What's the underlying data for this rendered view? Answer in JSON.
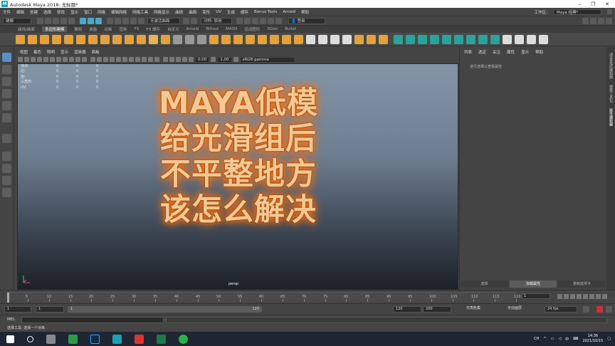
{
  "window": {
    "title": "Autodesk Maya 2018: 无标题*",
    "minimize": "–",
    "maximize": "❐",
    "close": "✕"
  },
  "menu": {
    "items": [
      "文件",
      "编辑",
      "创建",
      "选择",
      "修改",
      "显示",
      "窗口",
      "网格",
      "编辑网格",
      "网格工具",
      "网格显示",
      "曲线",
      "曲面",
      "变形",
      "UV",
      "生成",
      "缓存",
      "Bonus Tools",
      "Arnold",
      "帮助"
    ],
    "workspace_label": "工作区:",
    "workspace_value": "Maya 经典*"
  },
  "statusline": {
    "mode": "建模",
    "live_surface": "无激活曲面",
    "symmetry": "对称: 禁用",
    "login": "登录"
  },
  "shelf": {
    "tabs": [
      "曲线/曲面",
      "多边形建模",
      "雕刻",
      "装备",
      "动画",
      "渲染",
      "FX",
      "FX 缓存",
      "自定义",
      "Arnold",
      "Bifrost",
      "MASH",
      "运动图形",
      "XGen",
      "Bullet"
    ],
    "active_tab": "多边形建模"
  },
  "viewport": {
    "menu": [
      "视图",
      "着色",
      "照明",
      "显示",
      "渲染器",
      "面板"
    ],
    "toolbar": {
      "value_a": "0.00",
      "value_b": "1.00",
      "color_space": "sRGB gamma"
    },
    "hud": [
      {
        "label": "顶点:",
        "a": "0",
        "b": "0",
        "c": "0"
      },
      {
        "label": "边:",
        "a": "0",
        "b": "0",
        "c": "0"
      },
      {
        "label": "面:",
        "a": "0",
        "b": "0",
        "c": "0"
      },
      {
        "label": "三角形:",
        "a": "0",
        "b": "0",
        "c": "0"
      },
      {
        "label": "UV:",
        "a": "0",
        "b": "0",
        "c": "0"
      }
    ],
    "overlay_lines": [
      "MAYA低模",
      "给光滑组后",
      "不平整地方",
      "该怎么解决"
    ],
    "camera": "persp"
  },
  "channel_box": {
    "menu": [
      "列表",
      "选定",
      "关注",
      "属性",
      "显示",
      "帮助"
    ],
    "info": "进行选择以查看属性",
    "tabs": [
      "选择",
      "加载属性",
      "复制选项卡"
    ],
    "active_tab": "加载属性"
  },
  "side_tabs": [
    "通道盒/层编辑器",
    "建模工具包",
    "属性编辑器"
  ],
  "timeline": {
    "ticks": [
      "5",
      "10",
      "15",
      "20",
      "25",
      "30",
      "35",
      "40",
      "45",
      "50",
      "55",
      "60",
      "65",
      "70",
      "75",
      "80",
      "85",
      "90",
      "95",
      "100",
      "105",
      "110",
      "115",
      "120"
    ],
    "current_frame": "1"
  },
  "range": {
    "start": "1",
    "start2": "1",
    "slider_left": "1",
    "slider_right": "120",
    "end": "120",
    "end2": "200",
    "char_set": "无角色集",
    "anim_layer": "无动画层",
    "fps": "24 fps"
  },
  "command": {
    "label": "MEL"
  },
  "help": {
    "text": "选择工具: 选择一个对象"
  },
  "taskbar": {
    "ime": "中",
    "time": "14:36",
    "date": "2021/10/15",
    "lang": "CH"
  }
}
